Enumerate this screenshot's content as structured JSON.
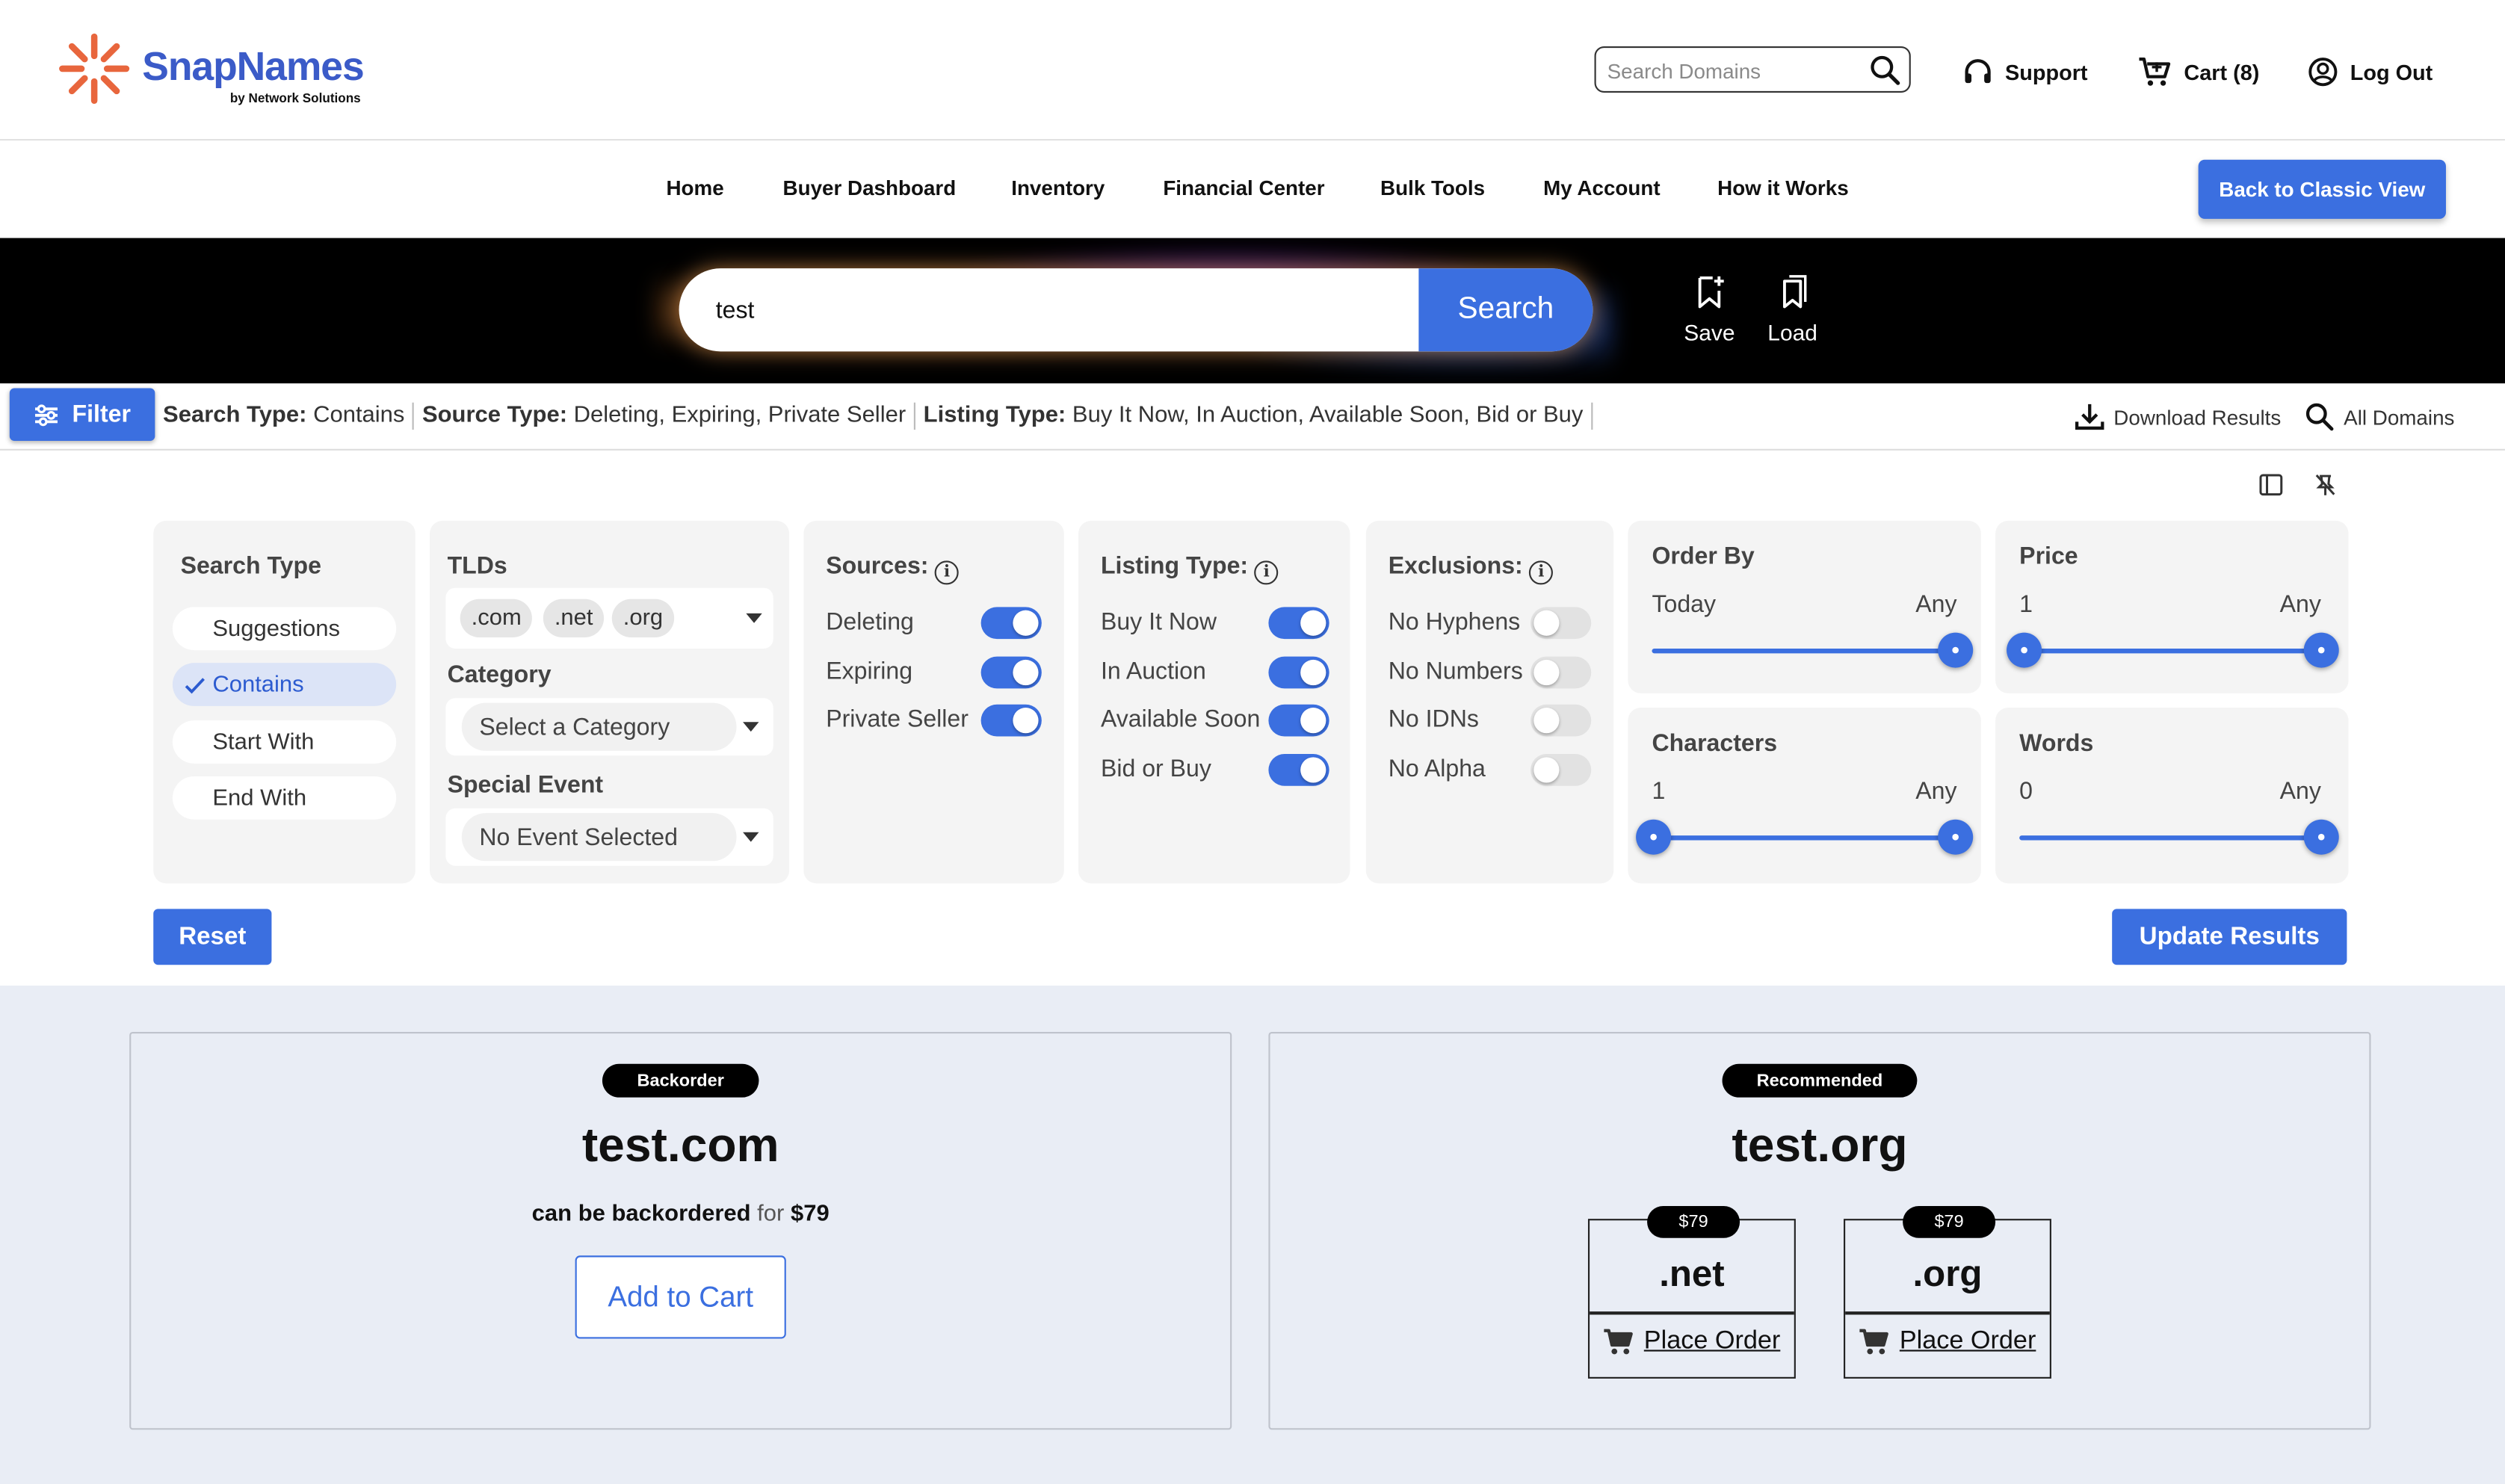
{
  "header": {
    "brand": "SnapNames",
    "brand_sub": "by Network Solutions",
    "search_placeholder": "Search Domains",
    "support": "Support",
    "cart": "Cart (8)",
    "logout": "Log Out"
  },
  "nav": {
    "items": [
      "Home",
      "Buyer Dashboard",
      "Inventory",
      "Financial Center",
      "Bulk Tools",
      "My Account",
      "How it Works"
    ],
    "classic_view": "Back to Classic View"
  },
  "search": {
    "query": "test",
    "button": "Search",
    "save": "Save",
    "load": "Load"
  },
  "summary": {
    "filter": "Filter",
    "search_type_label": "Search Type:",
    "search_type_value": "Contains",
    "source_type_label": "Source Type:",
    "source_type_value": "Deleting, Expiring, Private Seller",
    "listing_type_label": "Listing Type:",
    "listing_type_value": "Buy It Now, In Auction, Available Soon, Bid or Buy",
    "download": "Download Results",
    "all_domains": "All Domains"
  },
  "filters": {
    "search_type": {
      "title": "Search Type",
      "options": [
        "Suggestions",
        "Contains",
        "Start With",
        "End With"
      ],
      "selected": "Contains"
    },
    "tlds": {
      "title": "TLDs",
      "chips": [
        ".com",
        ".net",
        ".org"
      ],
      "category_title": "Category",
      "category_value": "Select a Category",
      "event_title": "Special Event",
      "event_value": "No Event Selected"
    },
    "sources": {
      "title": "Sources:",
      "items": [
        {
          "label": "Deleting",
          "on": true
        },
        {
          "label": "Expiring",
          "on": true
        },
        {
          "label": "Private Seller",
          "on": true
        }
      ]
    },
    "listing": {
      "title": "Listing Type:",
      "items": [
        {
          "label": "Buy It Now",
          "on": true
        },
        {
          "label": "In Auction",
          "on": true
        },
        {
          "label": "Available Soon",
          "on": true
        },
        {
          "label": "Bid or Buy",
          "on": true
        }
      ]
    },
    "exclusions": {
      "title": "Exclusions:",
      "items": [
        {
          "label": "No Hyphens",
          "on": false
        },
        {
          "label": "No Numbers",
          "on": false
        },
        {
          "label": "No IDNs",
          "on": false
        },
        {
          "label": "No Alpha",
          "on": false
        }
      ]
    },
    "order_by": {
      "title": "Order By",
      "min": "Today",
      "max": "Any"
    },
    "price": {
      "title": "Price",
      "min": "1",
      "max": "Any"
    },
    "characters": {
      "title": "Characters",
      "min": "1",
      "max": "Any"
    },
    "words": {
      "title": "Words",
      "min": "0",
      "max": "Any"
    },
    "reset": "Reset",
    "update": "Update Results"
  },
  "results": {
    "left": {
      "badge": "Backorder",
      "domain": "test.com",
      "desc_bold": "can be backordered",
      "desc_for": "for",
      "desc_price": "$79",
      "button": "Add to Cart"
    },
    "right": {
      "badge": "Recommended",
      "domain": "test.org",
      "options": [
        {
          "price": "$79",
          "ext": ".net",
          "action": "Place Order"
        },
        {
          "price": "$79",
          "ext": ".org",
          "action": "Place Order"
        }
      ]
    }
  },
  "colors": {
    "accent": "#3b6fe0",
    "brand": "#3b5bc8",
    "logo_orange": "#e8663d",
    "band": "#000000"
  }
}
